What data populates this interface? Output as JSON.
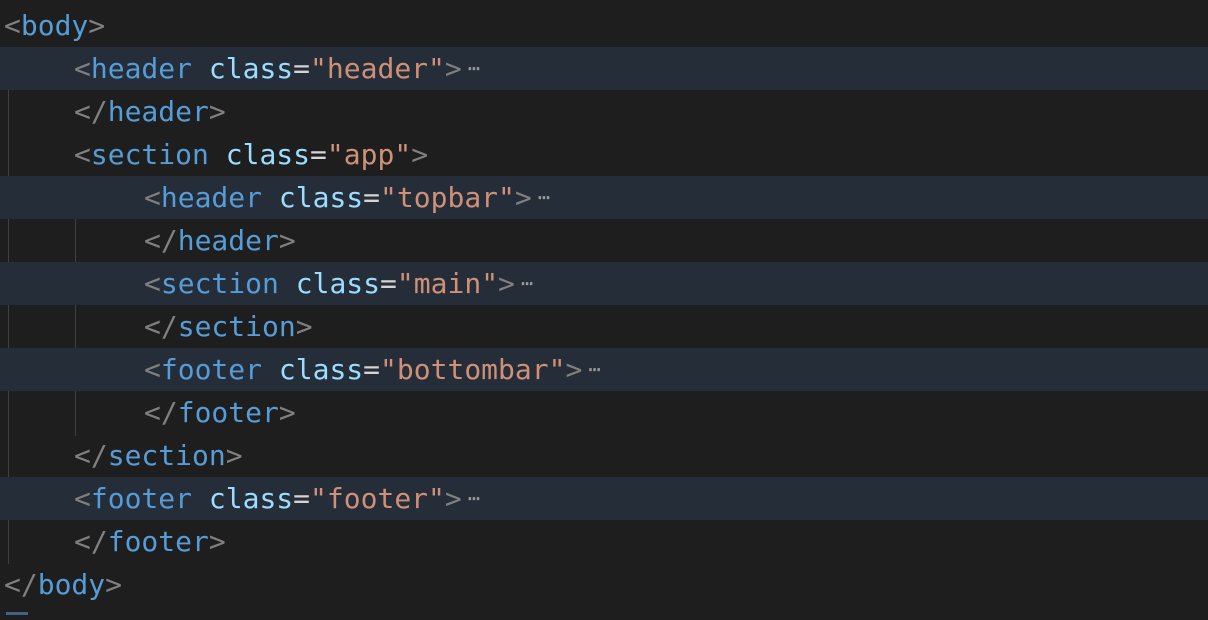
{
  "editor": {
    "lines": [
      {
        "indent": 0,
        "folded": false,
        "closing": false,
        "tag": "body"
      },
      {
        "indent": 1,
        "folded": true,
        "closing": false,
        "tag": "header",
        "attr": "class",
        "value": "header"
      },
      {
        "indent": 1,
        "folded": false,
        "closing": true,
        "tag": "header"
      },
      {
        "indent": 1,
        "folded": false,
        "closing": false,
        "tag": "section",
        "attr": "class",
        "value": "app"
      },
      {
        "indent": 2,
        "folded": true,
        "closing": false,
        "tag": "header",
        "attr": "class",
        "value": "topbar"
      },
      {
        "indent": 2,
        "folded": false,
        "closing": true,
        "tag": "header"
      },
      {
        "indent": 2,
        "folded": true,
        "closing": false,
        "tag": "section",
        "attr": "class",
        "value": "main"
      },
      {
        "indent": 2,
        "folded": false,
        "closing": true,
        "tag": "section"
      },
      {
        "indent": 2,
        "folded": true,
        "closing": false,
        "tag": "footer",
        "attr": "class",
        "value": "bottombar"
      },
      {
        "indent": 2,
        "folded": false,
        "closing": true,
        "tag": "footer"
      },
      {
        "indent": 1,
        "folded": false,
        "closing": true,
        "tag": "section"
      },
      {
        "indent": 1,
        "folded": true,
        "closing": false,
        "tag": "footer",
        "attr": "class",
        "value": "footer"
      },
      {
        "indent": 1,
        "folded": false,
        "closing": true,
        "tag": "footer"
      },
      {
        "indent": 0,
        "folded": false,
        "closing": true,
        "tag": "body"
      }
    ],
    "fold_marker": "⋯",
    "colors": {
      "background": "#1e1e1e",
      "folded_line": "#252d38",
      "bracket": "#808080",
      "tag": "#569cd6",
      "attribute": "#9cdcfe",
      "string": "#ce9178"
    }
  }
}
